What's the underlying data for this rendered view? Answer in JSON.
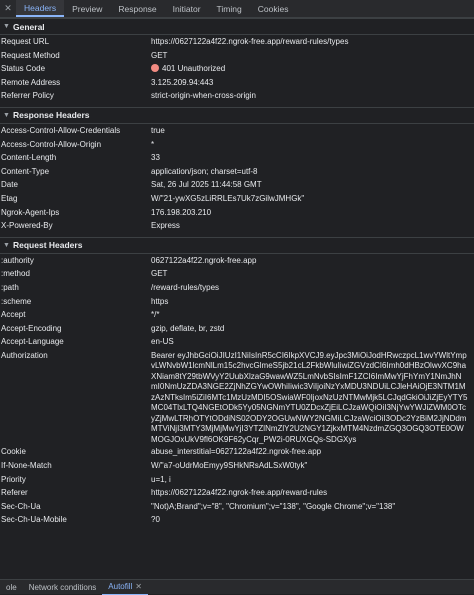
{
  "tabs": {
    "close_glyph": "✕",
    "items": [
      "Headers",
      "Preview",
      "Response",
      "Initiator",
      "Timing",
      "Cookies"
    ],
    "active_color": "#8ab4f8"
  },
  "general": {
    "title": "General",
    "rows": [
      {
        "k": "Request URL",
        "v": "https://0627122a4f22.ngrok-free.app/reward-rules/types"
      },
      {
        "k": "Request Method",
        "v": "GET"
      },
      {
        "k": "Status Code",
        "v": "401 Unauthorized"
      },
      {
        "k": "Remote Address",
        "v": "3.125.209.94:443"
      },
      {
        "k": "Referrer Policy",
        "v": "strict-origin-when-cross-origin"
      }
    ]
  },
  "response_headers": {
    "title": "Response Headers",
    "rows": [
      {
        "k": "Access-Control-Allow-Credentials",
        "v": "true"
      },
      {
        "k": "Access-Control-Allow-Origin",
        "v": "*"
      },
      {
        "k": "Content-Length",
        "v": "33"
      },
      {
        "k": "Content-Type",
        "v": "application/json; charset=utf-8"
      },
      {
        "k": "Date",
        "v": "Sat, 26 Jul 2025 11:44:58 GMT"
      },
      {
        "k": "Etag",
        "v": "W/\"21-ywXG5zLiRRLEs7Uk7zGilwJMHGk\""
      },
      {
        "k": "Ngrok-Agent-Ips",
        "v": "176.198.203.210"
      },
      {
        "k": "X-Powered-By",
        "v": "Express"
      }
    ]
  },
  "request_headers": {
    "title": "Request Headers",
    "rows": [
      {
        "k": ":authority",
        "v": "0627122a4f22.ngrok-free.app"
      },
      {
        "k": ":method",
        "v": "GET"
      },
      {
        "k": ":path",
        "v": "/reward-rules/types"
      },
      {
        "k": ":scheme",
        "v": "https"
      },
      {
        "k": "Accept",
        "v": "*/*"
      },
      {
        "k": "Accept-Encoding",
        "v": "gzip, deflate, br, zstd"
      },
      {
        "k": "Accept-Language",
        "v": "en-US"
      },
      {
        "k": "Authorization",
        "v": "Bearer eyJhbGciOiJIUzI1NiIsInR5cCI6IkpXVCJ9.eyJpc3MiOiJodHRwczpcL1wvYWltYmpvLWNvbW1lcmNlLm15c2hvcGlmeS5jb21cL2FkbWluIiwiZGVzdCI6Imh0dHBzOlwvXC9haXNiam8tY29tbWVyY2UubXlzaG9wawWZ5LmNvbSIsImF1ZCI6ImMwYjFhYmY1NmJhNmI0NmUzZDA3NGE2ZjNhZGYwOWhiIiwic3ViIjoiNzYxMDU3NDUiLCJleHAiOjE3NTM1MzAzNTksIm5iZiI6MTc1MzUzMDI5OSwiaWF0IjoxNzUzNTMwMjk5LCJqdGkiOiJiZjEyYTY5MC04TlxLTQ4NGEtODk5Yy05NGNmYTU0ZDcxZjEiLCJzaWQiOiI3NjYwYWJiZWM0OTcyZjMwLTRhOTYtODdiNS02ODY2OGUwNWY2NGMiLCJzaWciOiI3ODc2YzBiM2JjNDdmMTViNjI3MTY3MjMjMwYjI3YTZlNmZlY2U2NGY1ZjkxMTM4NzdmZGQ3OGQ3OTE0OWMOGJOxUkV9fl6OK9F62yCqr_PW2i-0RUXGQs-SDGXys"
      },
      {
        "k": "Cookie",
        "v": "abuse_interstitial=0627122a4f22.ngrok-free.app"
      },
      {
        "k": "If-None-Match",
        "v": "W/\"a7-oUdrMoEmyy9SHkNRsAdLSxW0tyk\""
      },
      {
        "k": "Priority",
        "v": "u=1, i"
      },
      {
        "k": "Referer",
        "v": "https://0627122a4f22.ngrok-free.app/reward-rules"
      },
      {
        "k": "Sec-Ch-Ua",
        "v": "\"Not)A;Brand\";v=\"8\", \"Chromium\";v=\"138\", \"Google Chrome\";v=\"138\""
      },
      {
        "k": "Sec-Ch-Ua-Mobile",
        "v": "?0"
      }
    ]
  },
  "bottom_bar": {
    "console_label": "ole",
    "network_conditions_label": "Network conditions",
    "autofill_label": "Autofill",
    "close_glyph": "✕"
  },
  "colors": {
    "background": "#202124",
    "status_error": "#f28b82"
  }
}
